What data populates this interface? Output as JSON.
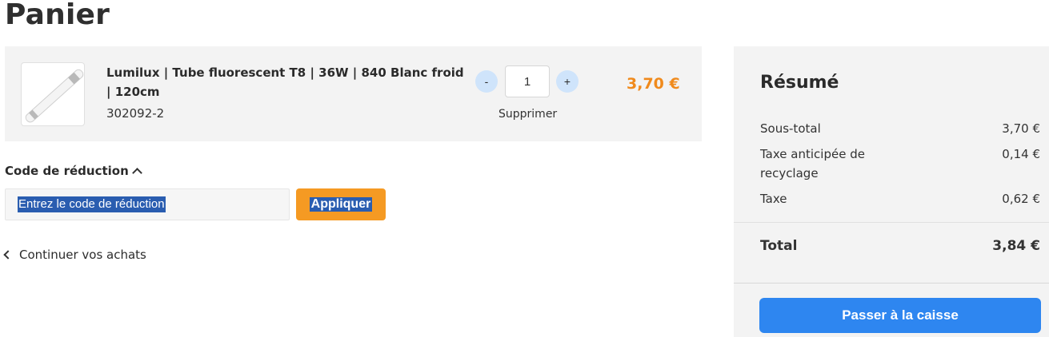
{
  "page": {
    "title": "Panier"
  },
  "cart": {
    "items": [
      {
        "name": "Lumilux | Tube fluorescent T8 | 36W | 840 Blanc froid | 120cm",
        "sku": "302092-2",
        "quantity": "1",
        "minus_label": "-",
        "plus_label": "+",
        "remove_label": "Supprimer",
        "price": "3,70 €",
        "image_icon": "fluorescent-tube-image"
      }
    ]
  },
  "discount": {
    "toggle_label": "Code de réduction",
    "placeholder": "Entrez le code de réduction",
    "apply_label": "Appliquer"
  },
  "continue_label": "Continuer vos achats",
  "summary": {
    "title": "Résumé",
    "subtotal_label": "Sous-total",
    "subtotal_value": "3,70 €",
    "eco_tax_label": "Taxe anticipée de recyclage",
    "eco_tax_value": "0,14 €",
    "tax_label": "Taxe",
    "tax_value": "0,62 €",
    "total_label": "Total",
    "total_value": "3,84 €",
    "checkout_label": "Passer à la caisse"
  },
  "colors": {
    "accent_orange": "#f59a23",
    "price_orange": "#f08a1c",
    "primary_blue": "#2e86f0",
    "qty_button_bg": "#cfe4fb",
    "panel_bg": "#f3f3f3",
    "selection_blue": "#2a5db0"
  }
}
